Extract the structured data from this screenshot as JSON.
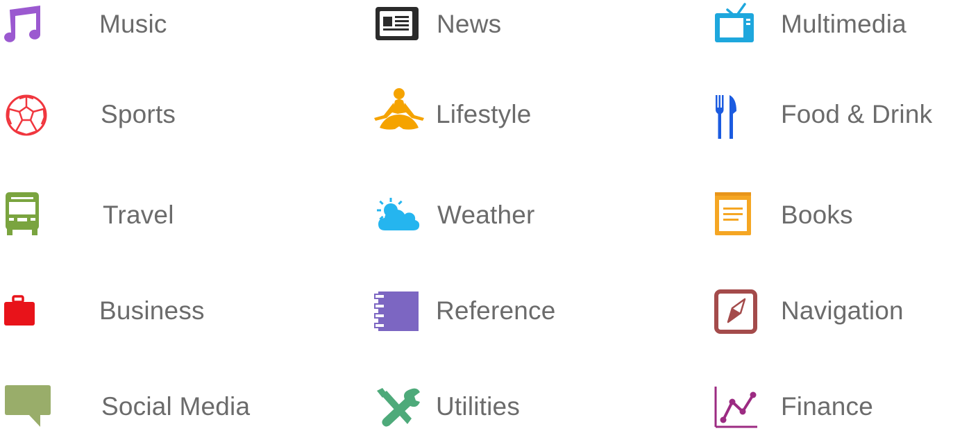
{
  "categories": [
    {
      "label": "Music",
      "icon": "music-note-icon",
      "color": "#9b59d0"
    },
    {
      "label": "News",
      "icon": "newspaper-icon",
      "color": "#2b2b2b"
    },
    {
      "label": "Multimedia",
      "icon": "television-icon",
      "color": "#1ea7dd"
    },
    {
      "label": "Sports",
      "icon": "soccer-ball-icon",
      "color": "#f0363e"
    },
    {
      "label": "Lifestyle",
      "icon": "yoga-figure-icon",
      "color": "#f5a300"
    },
    {
      "label": "Food & Drink",
      "icon": "fork-knife-icon",
      "color": "#1b5be0"
    },
    {
      "label": "Travel",
      "icon": "bus-icon",
      "color": "#7aa43f"
    },
    {
      "label": "Weather",
      "icon": "sun-cloud-icon",
      "color": "#25b5ef"
    },
    {
      "label": "Books",
      "icon": "notebook-icon",
      "color": "#f5a623"
    },
    {
      "label": "Business",
      "icon": "briefcase-icon",
      "color": "#e8131a"
    },
    {
      "label": "Reference",
      "icon": "spiral-notebook-icon",
      "color": "#7c66c2"
    },
    {
      "label": "Navigation",
      "icon": "compass-icon",
      "color": "#a44b4b"
    },
    {
      "label": "Social Media",
      "icon": "speech-bubble-icon",
      "color": "#99ad6a"
    },
    {
      "label": "Utilities",
      "icon": "wrench-screwdriver-icon",
      "color": "#4eaa7a"
    },
    {
      "label": "Finance",
      "icon": "line-graph-icon",
      "color": "#9c2b82"
    }
  ]
}
